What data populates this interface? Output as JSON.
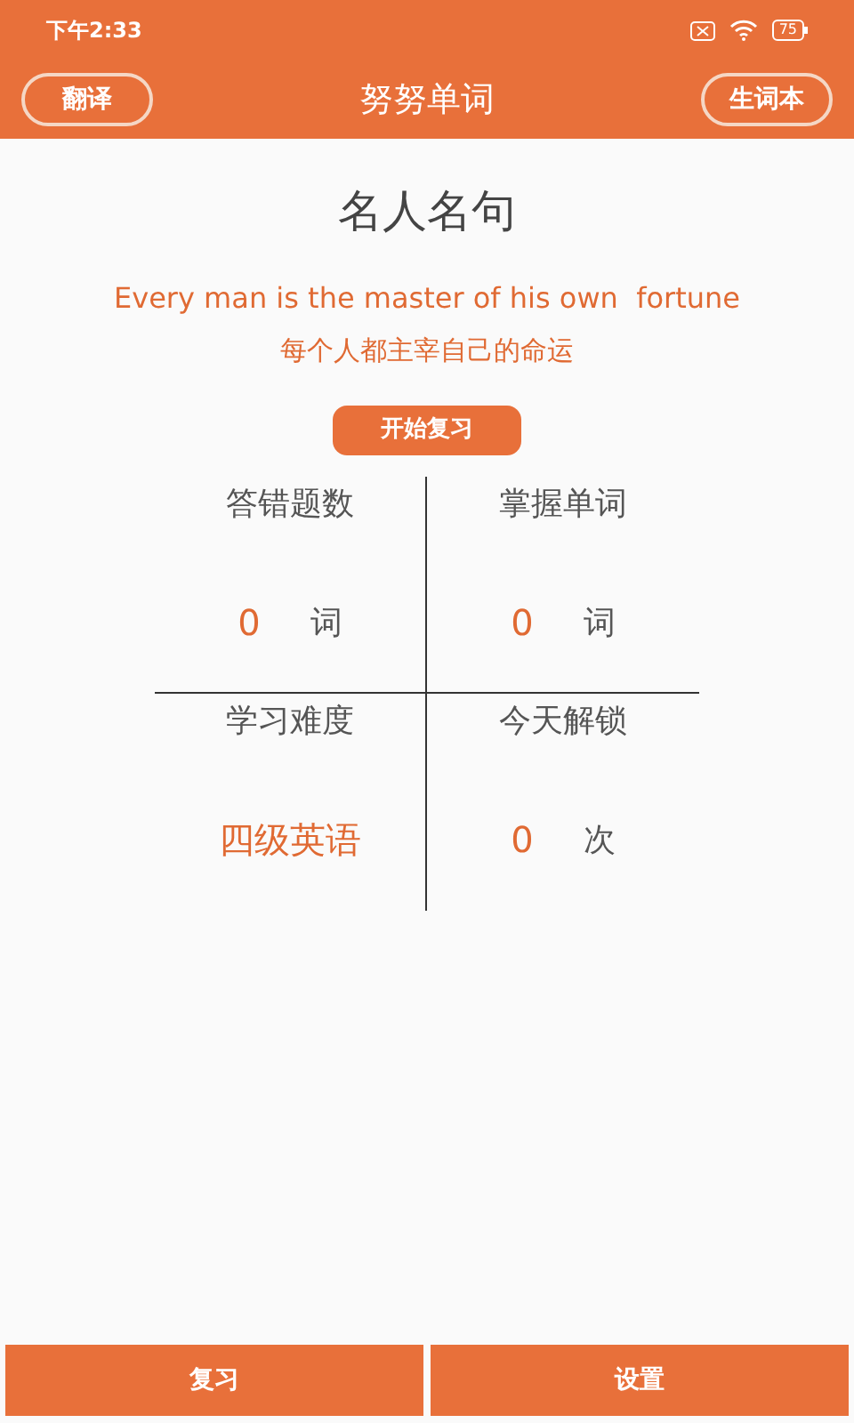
{
  "status_bar": {
    "time": "下午2:33",
    "battery": "75"
  },
  "header": {
    "left_button": "翻译",
    "title": "努努单词",
    "right_button": "生词本"
  },
  "quote": {
    "heading": "名人名句",
    "english": "Every man is the master of his own  fortune",
    "chinese": "每个人都主宰自己的命运"
  },
  "review_button": "开始复习",
  "stats": [
    {
      "label": "答错题数",
      "value": "0",
      "unit": "词"
    },
    {
      "label": "掌握单词",
      "value": "0",
      "unit": "词"
    },
    {
      "label": "学习难度",
      "value": "四级英语"
    },
    {
      "label": "今天解锁",
      "value": "0",
      "unit": "次"
    }
  ],
  "bottom_buttons": [
    "复习",
    "设置"
  ]
}
